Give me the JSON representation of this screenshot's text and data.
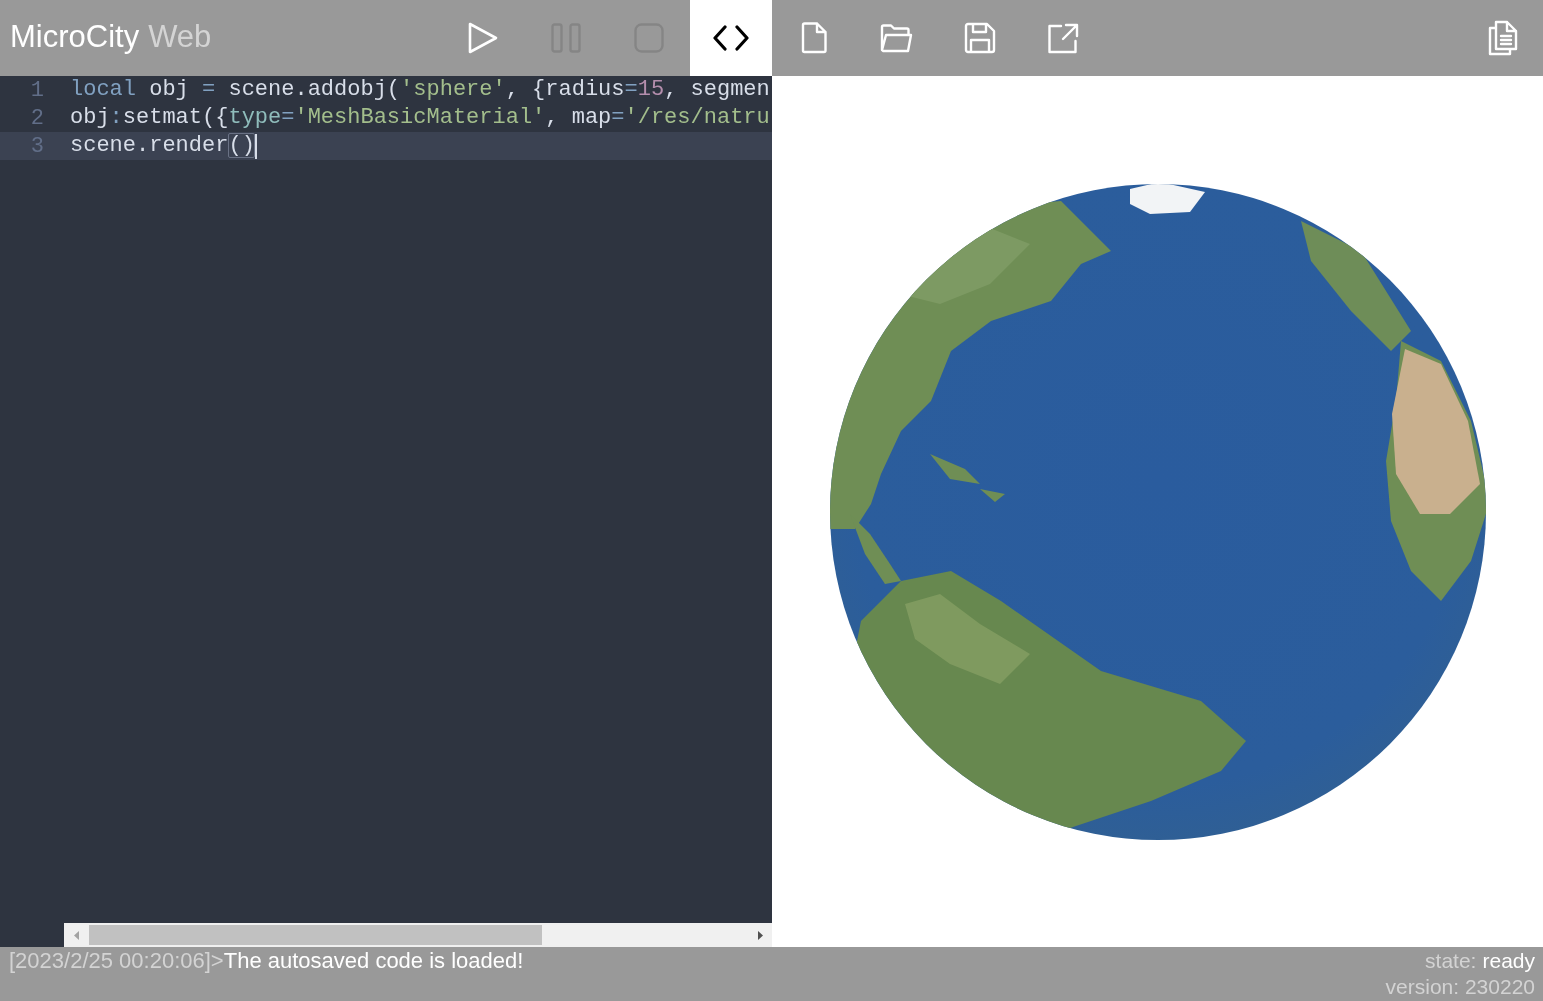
{
  "header": {
    "title": "MicroCity",
    "title_suffix": "Web",
    "run_controls": [
      {
        "kind": "play",
        "disabled": false
      },
      {
        "kind": "pause",
        "disabled": true
      },
      {
        "kind": "stop",
        "disabled": true
      }
    ],
    "view_toggle": {
      "kind": "code",
      "selected": true
    },
    "file_actions": [
      {
        "kind": "new"
      },
      {
        "kind": "open"
      },
      {
        "kind": "save"
      },
      {
        "kind": "export"
      }
    ],
    "help_action": {
      "kind": "docs"
    }
  },
  "editor": {
    "lines": [
      {
        "number": "1",
        "active": false,
        "tokens": [
          {
            "kind": "keyword",
            "text": "local"
          },
          {
            "kind": "plain",
            "text": " obj "
          },
          {
            "kind": "operator",
            "text": "="
          },
          {
            "kind": "plain",
            "text": " scene.addobj("
          },
          {
            "kind": "string",
            "text": "'sphere'"
          },
          {
            "kind": "plain",
            "text": ", {radius"
          },
          {
            "kind": "operator",
            "text": "="
          },
          {
            "kind": "number",
            "text": "15"
          },
          {
            "kind": "plain",
            "text": ", segmen"
          }
        ]
      },
      {
        "number": "2",
        "active": false,
        "tokens": [
          {
            "kind": "plain",
            "text": "obj"
          },
          {
            "kind": "operator",
            "text": ":"
          },
          {
            "kind": "plain",
            "text": "setmat({"
          },
          {
            "kind": "property",
            "text": "type"
          },
          {
            "kind": "operator",
            "text": "="
          },
          {
            "kind": "string",
            "text": "'MeshBasicMaterial'"
          },
          {
            "kind": "plain",
            "text": ", map"
          },
          {
            "kind": "operator",
            "text": "="
          },
          {
            "kind": "string",
            "text": "'/res/natru"
          }
        ]
      },
      {
        "number": "3",
        "active": true,
        "tokens": [
          {
            "kind": "plain",
            "text": "scene.render"
          },
          {
            "kind": "matched_bracket",
            "text": "()"
          }
        ]
      }
    ]
  },
  "console": {
    "timestamp": "[2023/2/25 00:20:06]",
    "prompt": ">",
    "message": "The autosaved code is loaded!"
  },
  "status": {
    "state_label": "state:",
    "state": "ready",
    "version": "version: 230220"
  }
}
